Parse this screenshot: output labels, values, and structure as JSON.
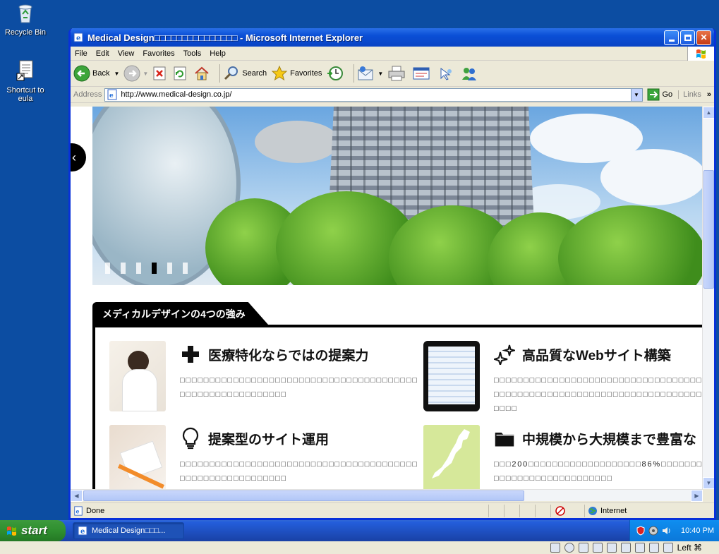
{
  "desktop": {
    "icons": [
      {
        "label": "Recycle Bin",
        "icon": "recycle-bin-icon"
      },
      {
        "label": "Shortcut to eula",
        "icon": "text-document-shortcut-icon"
      }
    ]
  },
  "window": {
    "title": "Medical Design□□□□□□□□□□□□□□□ - Microsoft Internet Explorer",
    "menu": [
      "File",
      "Edit",
      "View",
      "Favorites",
      "Tools",
      "Help"
    ],
    "toolbar": {
      "back": "Back",
      "search": "Search",
      "favorites": "Favorites"
    },
    "address": {
      "label": "Address",
      "url": "http://www.medical-design.co.jp/",
      "go": "Go",
      "links": "Links"
    },
    "status": {
      "text": "Done",
      "zone": "Internet"
    }
  },
  "page": {
    "slider": {
      "total_slides": 6,
      "active_slide": 4
    },
    "section_title": "メディカルデザインの4つの強み",
    "features": [
      {
        "title": "医療特化ならではの提案力",
        "icon": "plus-icon",
        "text": "□□□□□□□□□□□□□□□□□□□□□□□□□□□□□□□□□□□□□□□□□□□□□□□□□□□□□□□□□□"
      },
      {
        "title": "高品質なWebサイト構築",
        "icon": "sparkle-icon",
        "text": "□□□□□□□□□□□□□□□□□□□□□□□□□□□□□□□□□□□□□□□□□□□□□□□□□□□□□□□□□□□□□□□□□□□□□□□□□□"
      },
      {
        "title": "提案型のサイト運用",
        "icon": "lightbulb-icon",
        "text": "□□□□□□□□□□□□□□□□□□□□□□□□□□□□□□□□□□□□□□□□□□□□□□□□□□□□□□□□□□"
      },
      {
        "title": "中規模から大規模まで豊富な",
        "icon": "folder-icon",
        "text": "□□□200□□□□□□□□□□□□□□□□□□□86%□□□□□□□□□□□□□□□□□□□□□□□□□□□"
      }
    ]
  },
  "taskbar": {
    "start": "start",
    "task": "Medical Design□□□...",
    "clock": "10:40 PM"
  },
  "host_bar": {
    "keyboard": "Left ⌘"
  }
}
